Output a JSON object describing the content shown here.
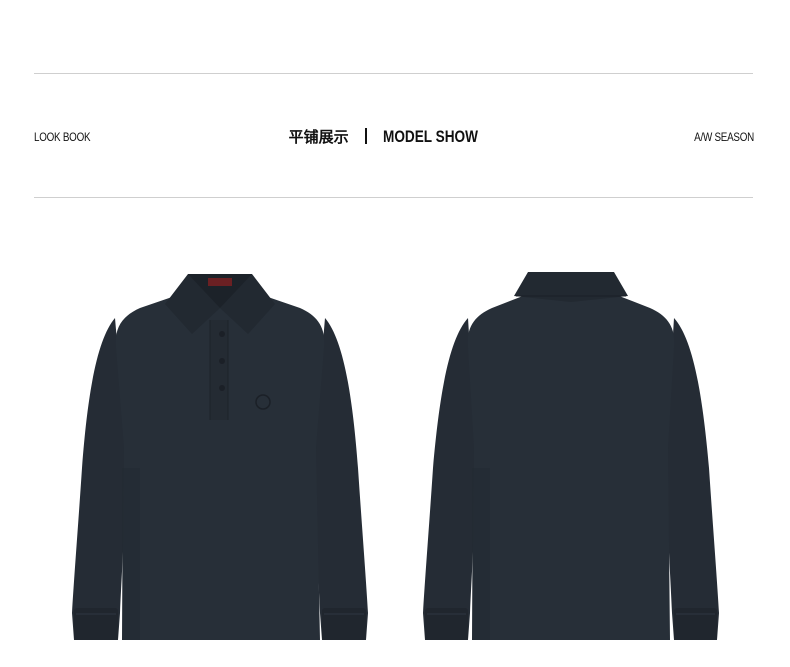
{
  "header": {
    "left_label": "LOOK BOOK",
    "title_cn": "平铺展示",
    "title_en": "MODEL SHOW",
    "right_label": "A/W SEASON"
  },
  "colors": {
    "shirt": "#272f38",
    "shirt_shade": "#1e252d",
    "rule": "#cfcfcf",
    "label_tag": "#8c1e22"
  },
  "images": {
    "front": "polo-shirt-front",
    "back": "polo-shirt-back"
  }
}
